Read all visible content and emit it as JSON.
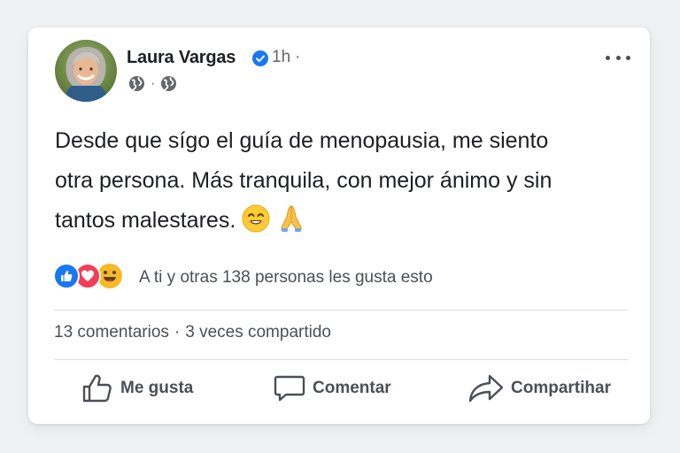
{
  "post": {
    "author": "Laura Vargas",
    "time": "1h",
    "time_dot": "·",
    "meta_sep": "·",
    "icons": {
      "verified": "verified-badge-icon",
      "audience": "globe-icon",
      "more": "more-options-icon"
    },
    "text_lines": [
      "Desde que sígo el guía de menopausia, me siento",
      "otra persona. Más tranquila, con mejor ánimo y sin",
      "tantos malestares."
    ],
    "emojis": [
      "smiling-face-emoji",
      "folded-hands-emoji"
    ]
  },
  "reactions": {
    "icons": [
      "like-reaction-icon",
      "love-reaction-icon",
      "haha-reaction-icon"
    ],
    "summary": "A ti y otras 138 personas les gusta esto"
  },
  "stats": {
    "comments": "13 comentarios",
    "separator": "·",
    "shares": "3 veces compartido"
  },
  "actions": {
    "like": "Me gusta",
    "comment": "Comentar",
    "share": "Compartihar"
  },
  "colors": {
    "like_blue": "#1877f2",
    "love_red": "#f33e58",
    "haha_yellow": "#f7b928",
    "verified_blue": "#1877f2"
  }
}
